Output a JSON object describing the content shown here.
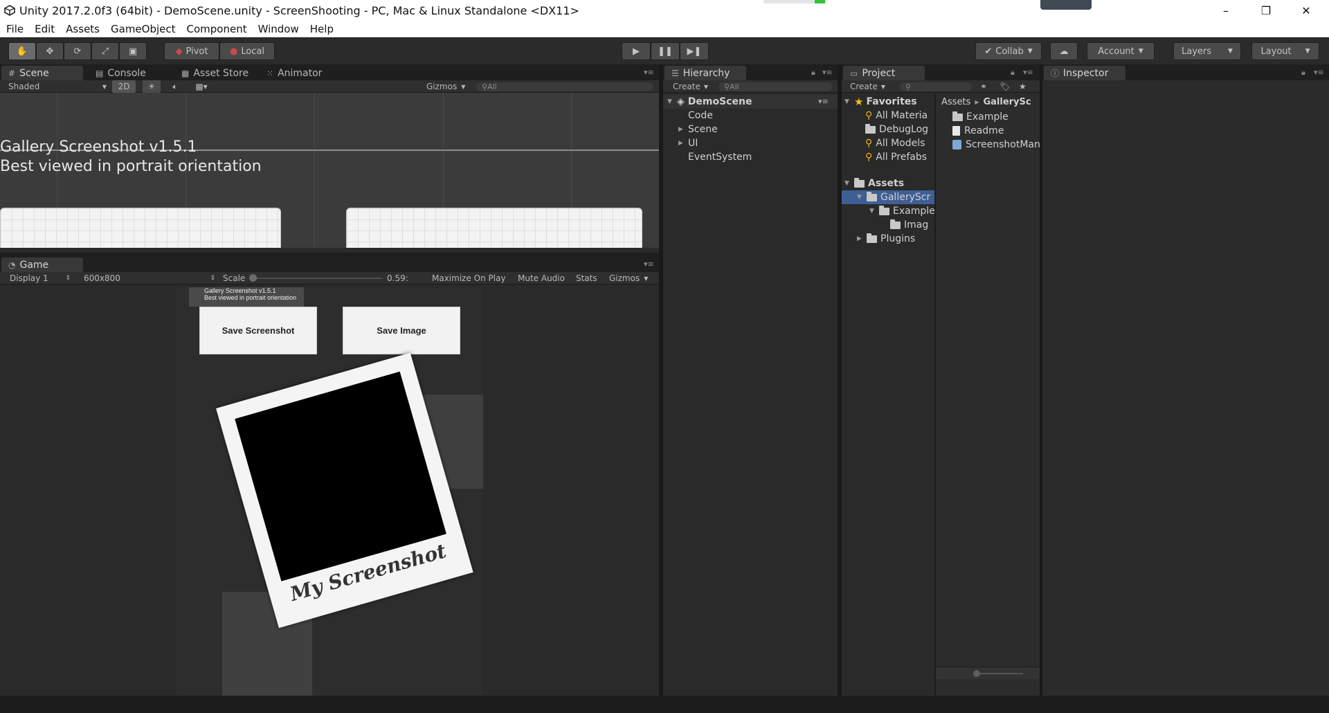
{
  "window": {
    "title": "Unity 2017.2.0f3 (64bit) - DemoScene.unity - ScreenShooting - PC, Mac & Linux Standalone <DX11>",
    "controls": [
      "–",
      "❐",
      "✕"
    ]
  },
  "menu": [
    "File",
    "Edit",
    "Assets",
    "GameObject",
    "Component",
    "Window",
    "Help"
  ],
  "toolbar": {
    "tools": [
      "hand-icon",
      "move-icon",
      "rotate-icon",
      "scale-icon",
      "rect-icon"
    ],
    "pivot": "Pivot",
    "local": "Local",
    "play": "▶",
    "pause": "❚❚",
    "step": "▶❚",
    "collab": "Collab",
    "account": "Account",
    "layers": "Layers",
    "layout": "Layout"
  },
  "scene_panel": {
    "tabs": [
      "Scene",
      "Console",
      "Asset Store",
      "Animator"
    ],
    "shading": "Shaded",
    "mode_2d": "2D",
    "gizmos": "Gizmos",
    "search_placeholder": "All",
    "text_line1": "Gallery Screenshot v1.5.1",
    "text_line2": "Best viewed in portrait orientation"
  },
  "game_panel": {
    "tab": "Game",
    "display": "Display 1",
    "resolution": "600x800",
    "scale_label": "Scale",
    "scale_value": "0.59:",
    "scale_slider_fraction": 0.0,
    "options": [
      "Maximize On Play",
      "Mute Audio",
      "Stats",
      "Gizmos"
    ],
    "overlay_line1": "Gallery Screenshot v1.5.1",
    "overlay_line2": "Best viewed in portrait orientation",
    "save_screenshot": "Save Screenshot",
    "save_image": "Save Image",
    "polaroid_caption": "My Screenshot"
  },
  "hierarchy": {
    "tab": "Hierarchy",
    "create": "Create",
    "search_placeholder": "All",
    "scene": "DemoScene",
    "items": [
      "Code",
      "Scene",
      "UI",
      "EventSystem"
    ]
  },
  "project": {
    "tab": "Project",
    "create": "Create",
    "favorites_label": "Favorites",
    "favorites": [
      "All Materia",
      "DebugLog",
      "All Models",
      "All Prefabs"
    ],
    "assets_label": "Assets",
    "tree": [
      "GalleryScr",
      "Example",
      "Imag",
      "Plugins"
    ],
    "breadcrumb_root": "Assets",
    "breadcrumb_current": "GallerySc",
    "files": [
      "Example",
      "Readme",
      "ScreenshotMan"
    ]
  },
  "inspector": {
    "tab": "Inspector"
  }
}
